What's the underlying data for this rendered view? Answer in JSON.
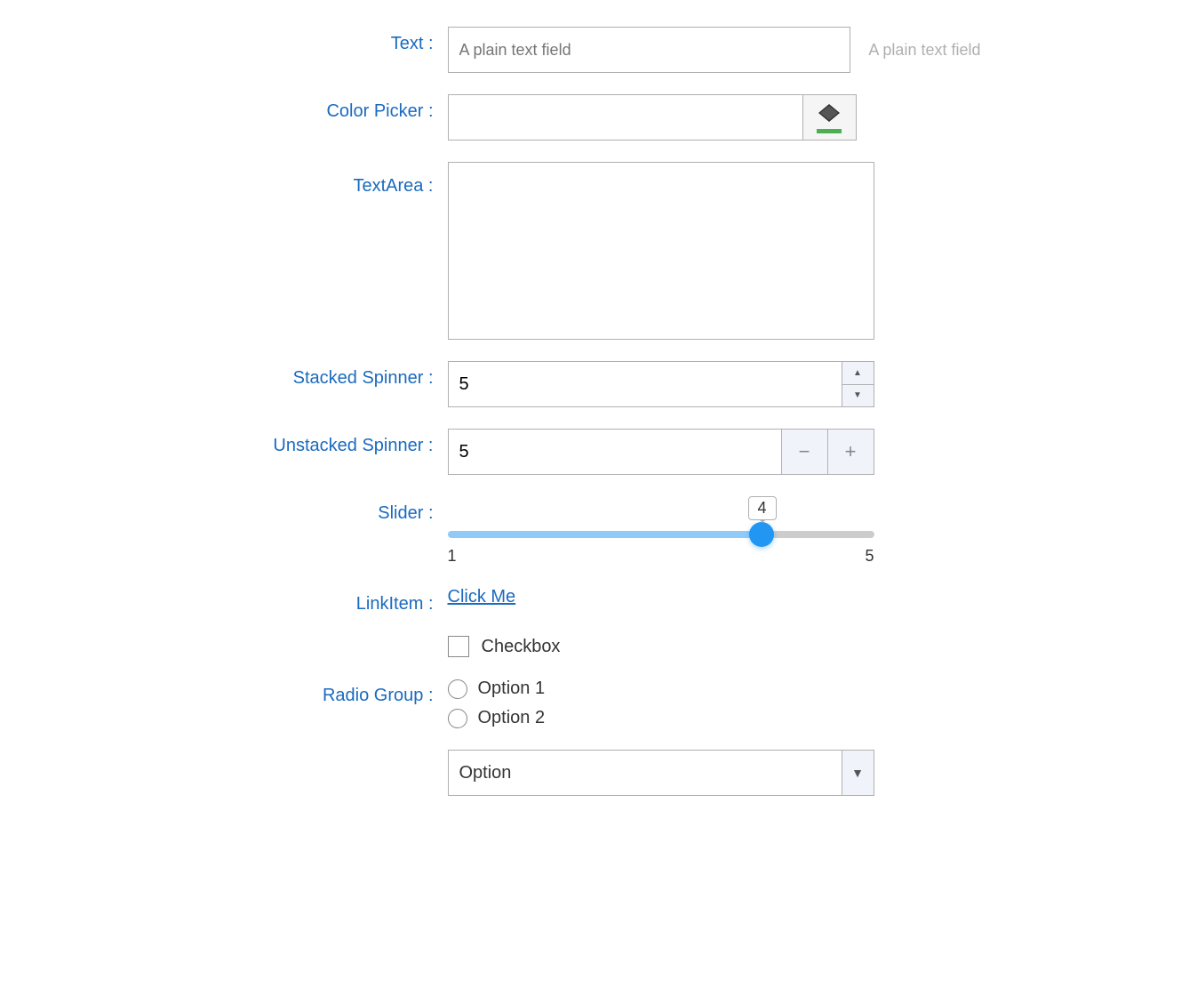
{
  "form": {
    "text_label": "Text :",
    "text_value": "",
    "text_placeholder": "A plain text field",
    "color_picker_label": "Color Picker :",
    "color_picker_value": "",
    "color_bar_color": "#4caf50",
    "textarea_label": "TextArea :",
    "textarea_value": "",
    "stacked_spinner_label": "Stacked Spinner :",
    "stacked_spinner_value": "5",
    "stacked_up": "▲",
    "stacked_down": "▼",
    "unstacked_spinner_label": "Unstacked Spinner :",
    "unstacked_spinner_value": "5",
    "unstacked_minus": "−",
    "unstacked_plus": "+",
    "slider_label": "Slider :",
    "slider_value": 4,
    "slider_min": 1,
    "slider_max": 5,
    "slider_min_label": "1",
    "slider_max_label": "5",
    "slider_tooltip": "4",
    "link_item_label": "LinkItem :",
    "link_item_text": "Click Me",
    "checkbox_label": "Checkbox",
    "radio_group_label": "Radio Group :",
    "radio_options": [
      {
        "label": "Option 1",
        "checked": false
      },
      {
        "label": "Option 2",
        "checked": false
      }
    ],
    "select_label": "Option",
    "select_value": "Option",
    "select_arrow": "▼"
  }
}
